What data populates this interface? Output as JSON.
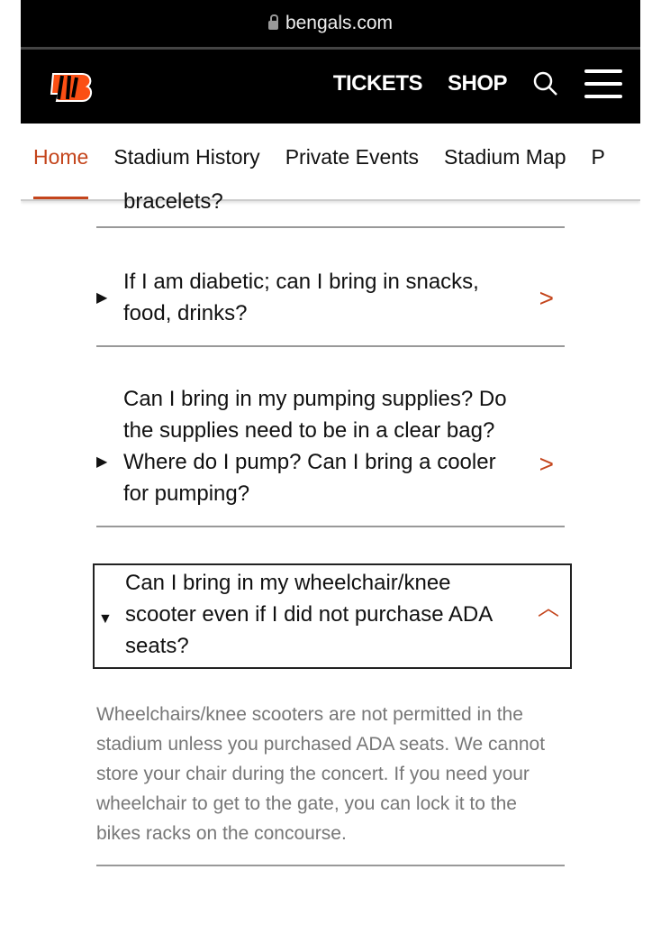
{
  "browser": {
    "url": "bengals.com"
  },
  "header": {
    "tickets": "TICKETS",
    "shop": "SHOP",
    "brand_color": "#FB4F14"
  },
  "subnav": [
    "Home",
    "Stadium History",
    "Private Events",
    "Stadium Map",
    "P"
  ],
  "faq": [
    {
      "q": "bracelets?",
      "state": "partial"
    },
    {
      "q": "If I am diabetic; can I bring in snacks, food, drinks?",
      "state": "collapsed"
    },
    {
      "q": "Can I bring in my pumping supplies? Do the supplies need to be in a clear bag? Where do I pump? Can I bring a cooler for pumping?",
      "state": "collapsed"
    },
    {
      "q": "Can I bring in my wheelchair/knee scooter even if I did not purchase ADA seats?",
      "state": "expanded",
      "a": "Wheelchairs/knee scooters are not permitted in the stadium unless you purchased ADA seats. We cannot store your chair during the concert. If you need your wheelchair to get to the gate, you can lock it to the bikes racks on the concourse."
    }
  ]
}
